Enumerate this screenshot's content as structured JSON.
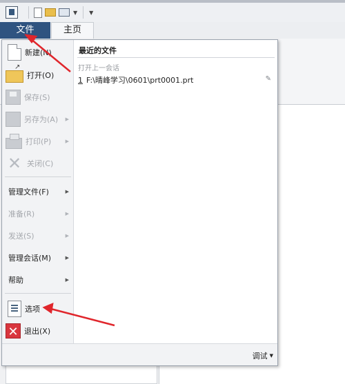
{
  "tabs": {
    "file": "文件",
    "home": "主页"
  },
  "file_menu": {
    "items": [
      {
        "label": "新建(N)",
        "enabled": true,
        "has_submenu": false,
        "icon": "new-document-icon"
      },
      {
        "label": "打开(O)",
        "enabled": true,
        "has_submenu": false,
        "icon": "open-folder-icon"
      },
      {
        "label": "保存(S)",
        "enabled": false,
        "has_submenu": false,
        "icon": "save-icon"
      },
      {
        "label": "另存为(A)",
        "enabled": false,
        "has_submenu": true,
        "icon": "save-as-icon"
      },
      {
        "label": "打印(P)",
        "enabled": false,
        "has_submenu": true,
        "icon": "print-icon"
      },
      {
        "label": "关闭(C)",
        "enabled": false,
        "has_submenu": false,
        "icon": "close-x-icon"
      },
      {
        "label": "管理文件(F)",
        "enabled": true,
        "has_submenu": true
      },
      {
        "label": "准备(R)",
        "enabled": false,
        "has_submenu": true
      },
      {
        "label": "发送(S)",
        "enabled": false,
        "has_submenu": true
      },
      {
        "label": "管理会话(M)",
        "enabled": true,
        "has_submenu": true
      },
      {
        "label": "帮助",
        "enabled": true,
        "has_submenu": true
      },
      {
        "label": "选项",
        "enabled": true,
        "has_submenu": false,
        "icon": "options-icon"
      },
      {
        "label": "退出(X)",
        "enabled": true,
        "has_submenu": false,
        "icon": "exit-icon"
      }
    ],
    "recent": {
      "title": "最近的文件",
      "previous_session": "打开上一会话",
      "files": [
        {
          "num": "1",
          "path": "F:\\晴峰学习\\0601\\prt0001.prt"
        }
      ]
    },
    "footer": {
      "debug_label": "调试"
    }
  },
  "colors": {
    "file_tab": "#2f5380",
    "annotation": "#e0262c",
    "exit": "#d9363e"
  }
}
